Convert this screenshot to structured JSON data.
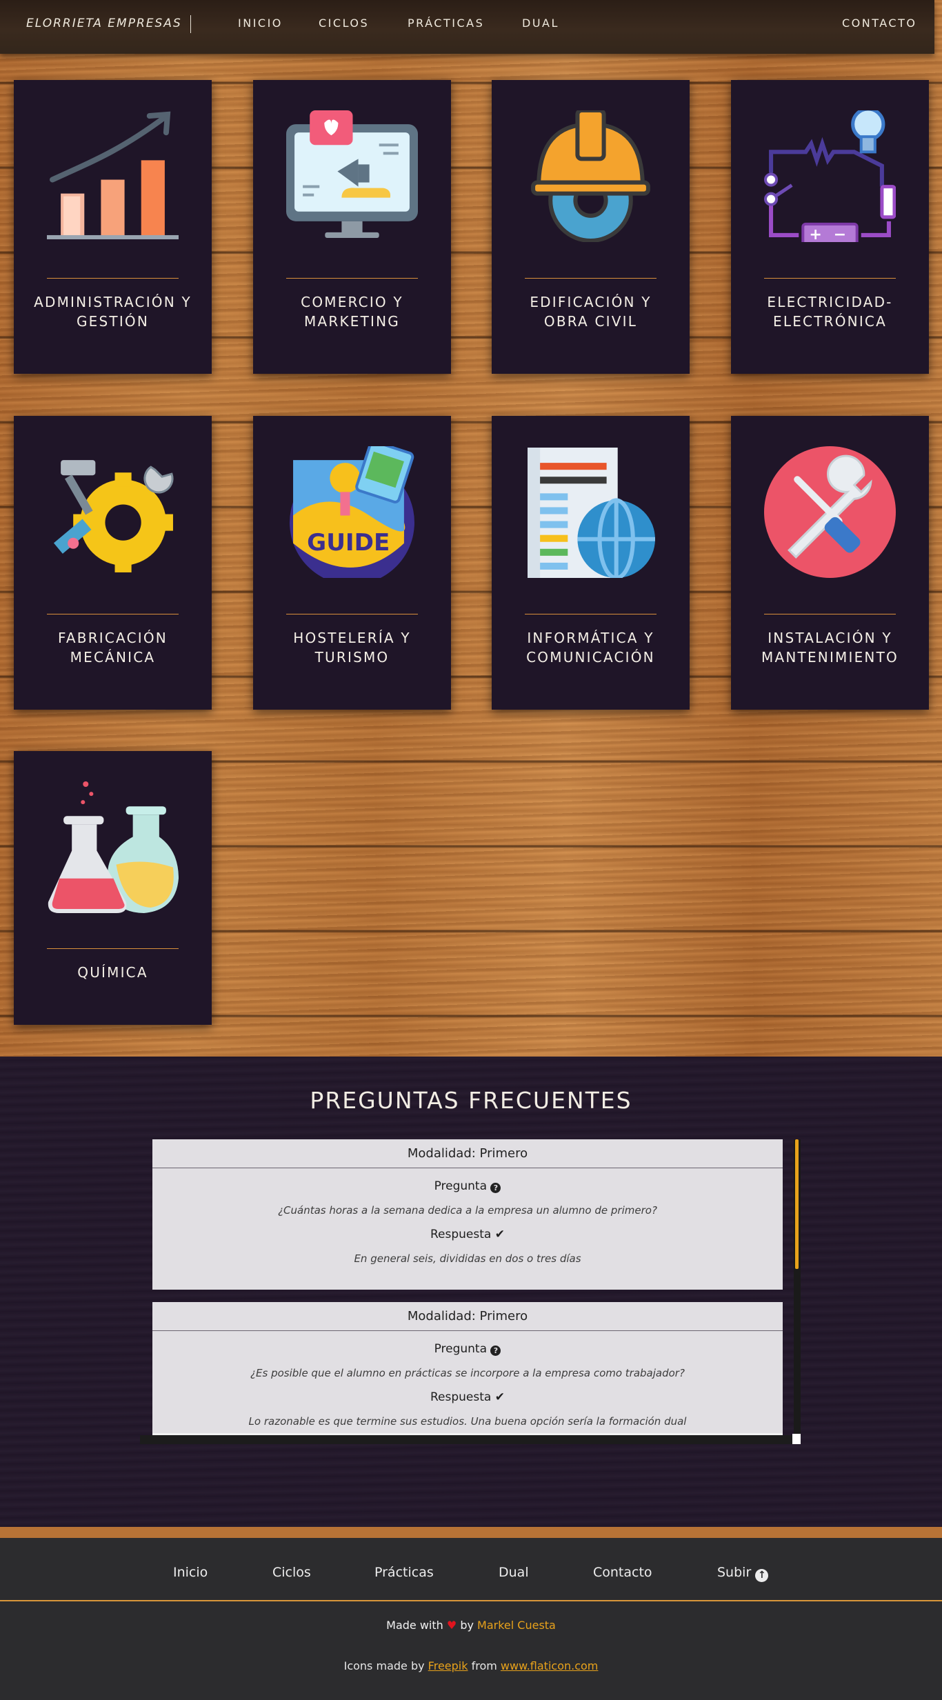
{
  "header": {
    "brand": "ELORRIETA EMPRESAS",
    "nav": [
      "INICIO",
      "CICLOS",
      "PRÁCTICAS",
      "DUAL"
    ],
    "contact": "CONTACTO"
  },
  "cards": [
    {
      "label": "ADMINISTRACIÓN Y GESTIÓN",
      "line1": "ADMINISTRACIÓN Y",
      "line2": "GESTIÓN",
      "icon": "growth-chart-icon"
    },
    {
      "label": "COMERCIO Y MARKETING",
      "line1": "COMERCIO Y",
      "line2": "MARKETING",
      "icon": "marketing-monitor-icon"
    },
    {
      "label": "EDIFICACIÓN Y OBRA CIVIL",
      "line1": "EDIFICACIÓN Y",
      "line2": "OBRA CIVIL",
      "icon": "helmet-gear-icon"
    },
    {
      "label": "ELECTRICIDAD-ELECTRÓNICA",
      "line1": "ELECTRICIDAD-",
      "line2": "ELECTRÓNICA",
      "icon": "circuit-icon"
    },
    {
      "label": "FABRICACIÓN MECÁNICA",
      "line1": "FABRICACIÓN",
      "line2": "MECÁNICA",
      "icon": "tools-gear-icon"
    },
    {
      "label": "HOSTELERÍA Y TURISMO",
      "line1": "HOSTELERÍA Y",
      "line2": "TURISMO",
      "icon": "travel-guide-icon"
    },
    {
      "label": "INFORMÁTICA Y COMUNICACIÓN",
      "line1": "INFORMÁTICA Y",
      "line2": "COMUNICACIÓN",
      "icon": "document-globe-icon"
    },
    {
      "label": "INSTALACIÓN Y MANTENIMIENTO",
      "line1": "INSTALACIÓN Y",
      "line2": "MANTENIMIENTO",
      "icon": "wrench-screwdriver-icon"
    },
    {
      "label": "QUÍMICA",
      "line1": "QUÍMICA",
      "line2": "",
      "icon": "flasks-icon"
    }
  ],
  "faq": {
    "title": "PREGUNTAS FRECUENTES",
    "items": [
      {
        "mode": "Modalidad: Primero",
        "question_label": "Pregunta",
        "question": "¿Cuántas horas a la semana dedica a la empresa un alumno de primero?",
        "answer_label": "Respuesta",
        "answer": "En general seis, divididas en dos o tres días"
      },
      {
        "mode": "Modalidad: Primero",
        "question_label": "Pregunta",
        "question": "¿Es posible que el alumno en prácticas se incorpore a la empresa como trabajador?",
        "answer_label": "Respuesta",
        "answer": "Lo razonable es que termine sus estudios. Una buena opción sería la formación dual"
      }
    ]
  },
  "footer": {
    "nav": [
      "Inicio",
      "Ciclos",
      "Prácticas",
      "Dual",
      "Contacto"
    ],
    "up": "Subir",
    "made_prefix": "Made with",
    "made_by": "by",
    "made_name": "Markel Cuesta",
    "credits_prefix": "Icons made by",
    "credits_author": "Freepik",
    "credits_from": "from",
    "credits_site": "www.flaticon.com"
  },
  "colors": {
    "accent": "#e8a21b",
    "card_bg": "#1f1528",
    "faq_bg": "#23182b",
    "footer_bg": "#2c2c2e"
  }
}
